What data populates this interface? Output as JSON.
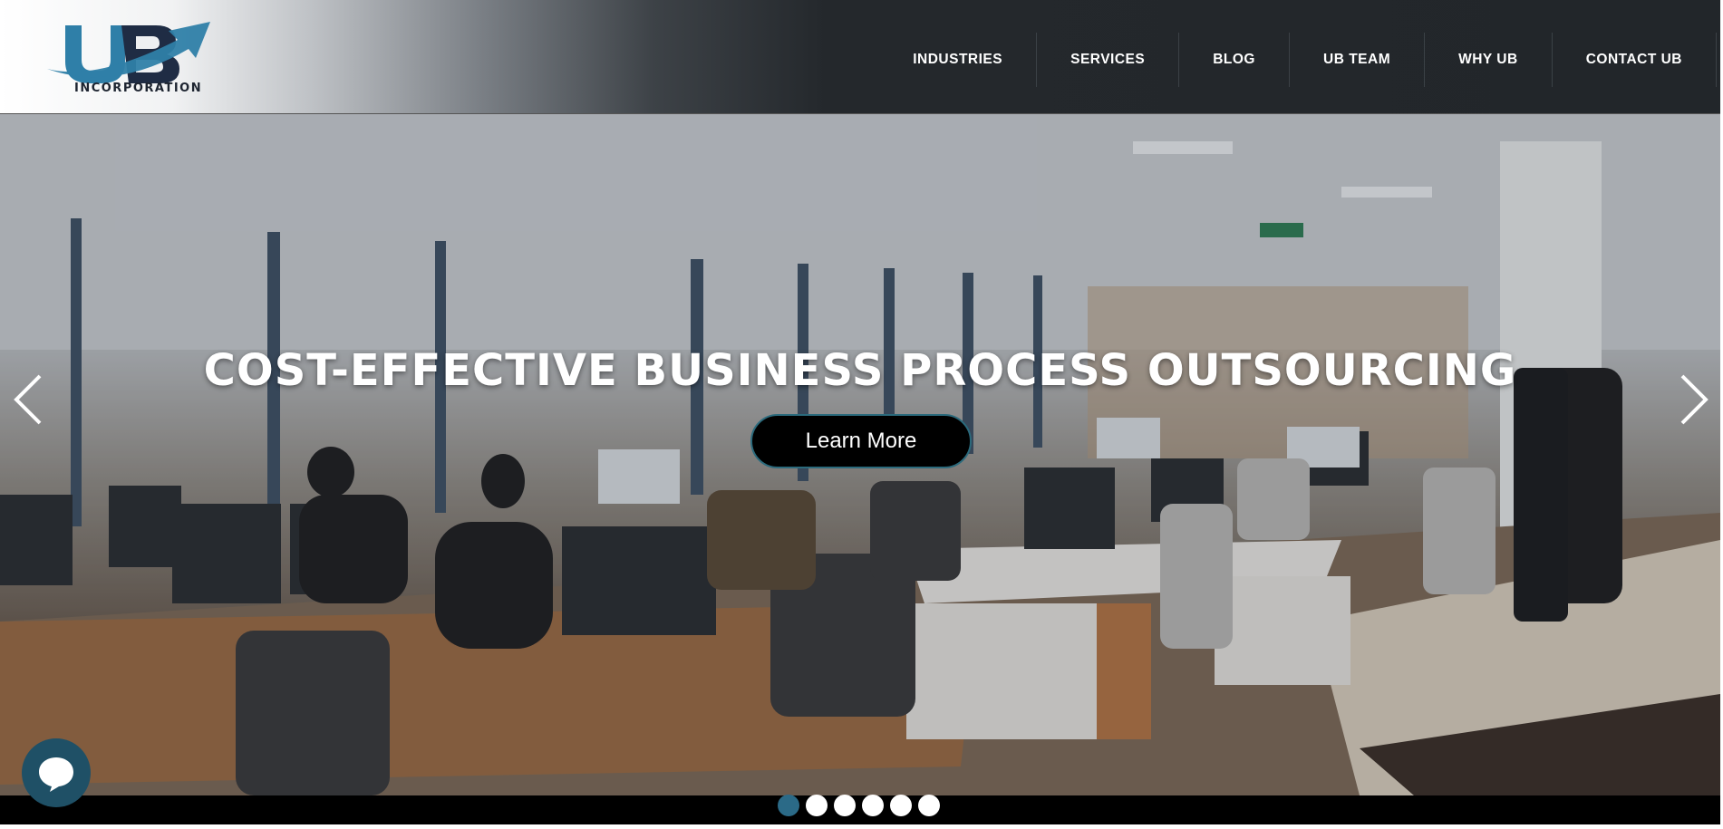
{
  "header": {
    "logo_text": "INCORPORATION",
    "logo_icon": "ub-logo-icon",
    "nav": [
      {
        "label": "INDUSTRIES"
      },
      {
        "label": "SERVICES"
      },
      {
        "label": "BLOG"
      },
      {
        "label": "UB TEAM"
      },
      {
        "label": "WHY UB"
      },
      {
        "label": "CONTACT UB"
      }
    ]
  },
  "hero": {
    "headline": "COST-EFFECTIVE BUSINESS PROCESS OUTSOURCING",
    "cta_label": "Learn More",
    "prev_icon": "chevron-left-icon",
    "next_icon": "chevron-right-icon",
    "slide_count": 6,
    "active_slide": 1
  },
  "chat": {
    "icon": "chat-bubble-icon"
  },
  "colors": {
    "accent": "#2b6a87",
    "cta_bg": "#000000",
    "header_dark": "#22262a",
    "logo_blue": "#2f7fa8"
  }
}
